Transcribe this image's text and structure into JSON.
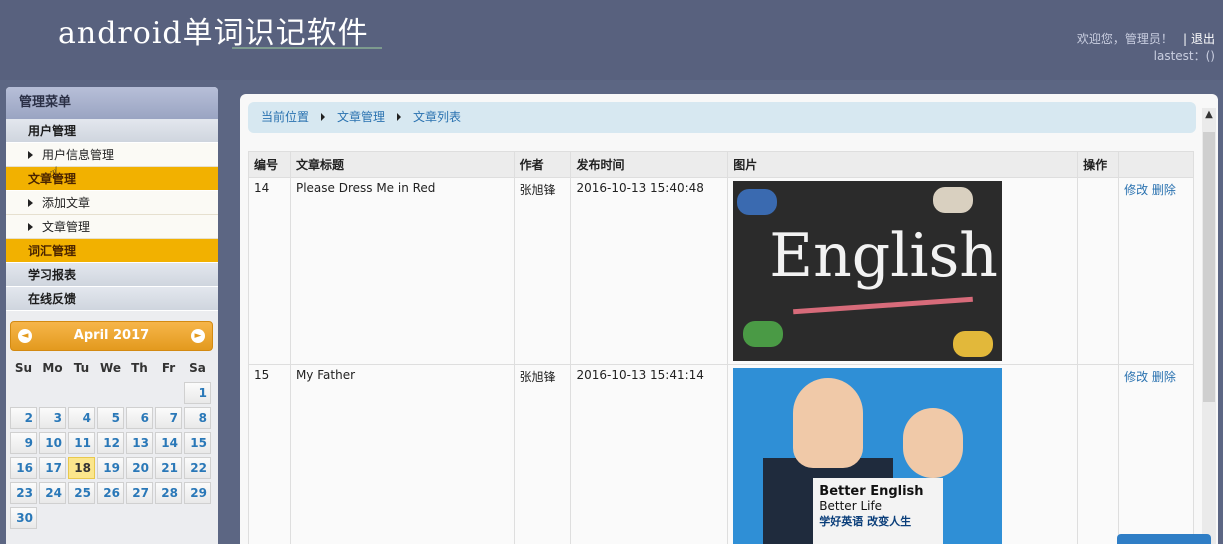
{
  "header": {
    "app_title": "android单词识记软件",
    "welcome": "欢迎您，管理员！",
    "logout": "退出",
    "user_line": "lastest：()"
  },
  "sidebar": {
    "title": "管理菜单",
    "groups": [
      {
        "label": "用户管理",
        "active": false,
        "items": [
          "用户信息管理"
        ]
      },
      {
        "label": "文章管理",
        "active": true,
        "items": [
          "添加文章",
          "文章管理"
        ]
      },
      {
        "label": "词汇管理",
        "active": true,
        "items": []
      },
      {
        "label": "学习报表",
        "active": false,
        "items": []
      },
      {
        "label": "在线反馈",
        "active": false,
        "items": []
      }
    ]
  },
  "calendar": {
    "month_label": "April 2017",
    "prev_icon": "◄",
    "next_icon": "►",
    "weekdays": [
      "Su",
      "Mo",
      "Tu",
      "We",
      "Th",
      "Fr",
      "Sa"
    ],
    "first_weekday_index": 6,
    "days_in_month": 30,
    "today": 18
  },
  "breadcrumb": [
    "当前位置",
    "文章管理",
    "文章列表"
  ],
  "table": {
    "headers": [
      "编号",
      "文章标题",
      "作者",
      "发布时间",
      "图片",
      "操作"
    ],
    "rows": [
      {
        "id": "14",
        "title": "Please Dress Me in Red",
        "author": "张旭锋",
        "time": "2016-10-13 15:40:48",
        "image_text": "English",
        "edit": "修改",
        "delete": "删除"
      },
      {
        "id": "15",
        "title": "My Father",
        "author": "张旭锋",
        "time": "2016-10-13 15:41:14",
        "image_text_1": "Better English",
        "image_text_2": "Better Life",
        "image_text_3": "学好英语 改变人生",
        "edit": "修改",
        "delete": "删除"
      }
    ]
  },
  "colors": {
    "header_bg": "#58617e",
    "active_menu": "#f2b100",
    "link": "#2a72b0",
    "calendar_head": "#e39a1e"
  }
}
